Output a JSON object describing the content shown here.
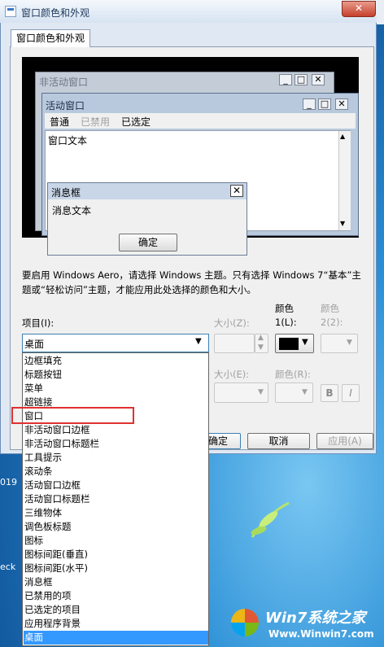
{
  "dialog": {
    "title": "窗口颜色和外观",
    "close_glyph": "✕",
    "tab_label": "窗口颜色和外观"
  },
  "preview": {
    "inactive_title": "非活动窗口",
    "active_title": "活动窗口",
    "menu_items": [
      "普通",
      "已禁用",
      "已选定"
    ],
    "window_text": "窗口文本",
    "msgbox_title": "消息框",
    "msgbox_text": "消息文本",
    "ok_label": "确定"
  },
  "info_text": "要启用 Windows Aero，请选择 Windows 主题。只有选择 Windows 7“基本”主题或“轻松访问”主题，才能应用此处选择的颜色和大小。",
  "form": {
    "item_label": "项目(I):",
    "size_label": "大小(Z):",
    "color1_label_line1": "颜色",
    "color1_label_line2": "1(L):",
    "color2_label_line1": "颜色",
    "color2_label_line2": "2(2):",
    "item_selected": "桌面",
    "font_size_label": "大小(E):",
    "font_color_label": "颜色(R):",
    "bold_label": "B",
    "italic_label": "I",
    "color1_value": "#000000"
  },
  "buttons": {
    "ok": "确定",
    "cancel": "取消",
    "apply": "应用(A)"
  },
  "dropdown": {
    "options": [
      "边框填充",
      "标题按钮",
      "菜单",
      "超链接",
      "窗口",
      "非活动窗口边框",
      "非活动窗口标题栏",
      "工具提示",
      "滚动条",
      "活动窗口边框",
      "活动窗口标题栏",
      "三维物体",
      "调色板标题",
      "图标",
      "图标间距(垂直)",
      "图标间距(水平)",
      "消息框",
      "已禁用的项",
      "已选定的项目",
      "应用程序背景",
      "桌面"
    ],
    "selected_index": 20,
    "highlighted_index": 4
  },
  "desktop": {
    "label_1": "019",
    "label_2": "eck",
    "watermark_brand": "Win7系统之家",
    "watermark_url": "Www.Winwin7.com"
  }
}
